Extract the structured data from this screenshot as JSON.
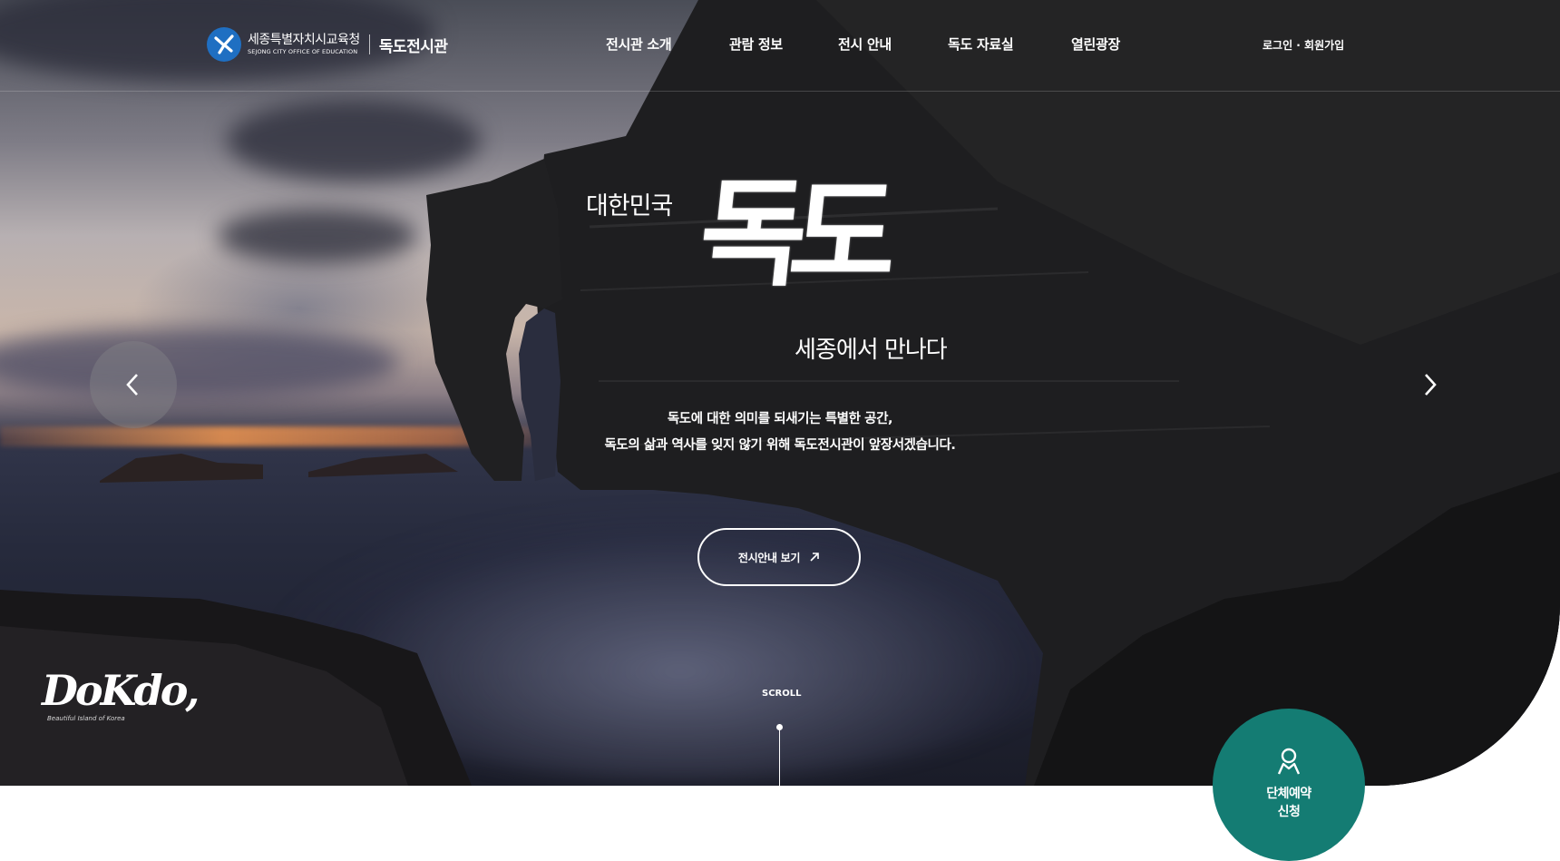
{
  "header": {
    "org_name_ko": "세종특별자치시교육청",
    "org_name_en": "SEJONG CITY OFFICE OF EDUCATION",
    "site_name": "독도전시관",
    "nav": [
      {
        "label": "전시관 소개"
      },
      {
        "label": "관람 정보"
      },
      {
        "label": "전시 안내"
      },
      {
        "label": "독도 자료실"
      },
      {
        "label": "열린광장"
      }
    ],
    "login_label": "로그인 · 회원가입"
  },
  "hero": {
    "pre_title": "대한민국",
    "title": "독도",
    "post_title": "세종에서 만나다",
    "desc_line1": "독도에 대한 의미를 되새기는 특별한 공간,",
    "desc_line2": "독도의 삶과 역사를 잊지 않기 위해 독도전시관이 앞장서겠습니다.",
    "cta_label": "전시안내 보기",
    "scroll_label": "SCROLL",
    "dokdo_word": "DoKdo,",
    "dokdo_sub": "Beautiful Island of Korea"
  },
  "reservation": {
    "line1": "단체예약",
    "line2": "신청"
  },
  "colors": {
    "reservation_bg": "#147c73",
    "logo_blue": "#1f6fc2"
  },
  "icons": {
    "prev": "chevron-left-icon",
    "next": "chevron-right-icon",
    "cta": "arrow-up-right-icon",
    "reservation": "person-icon"
  }
}
